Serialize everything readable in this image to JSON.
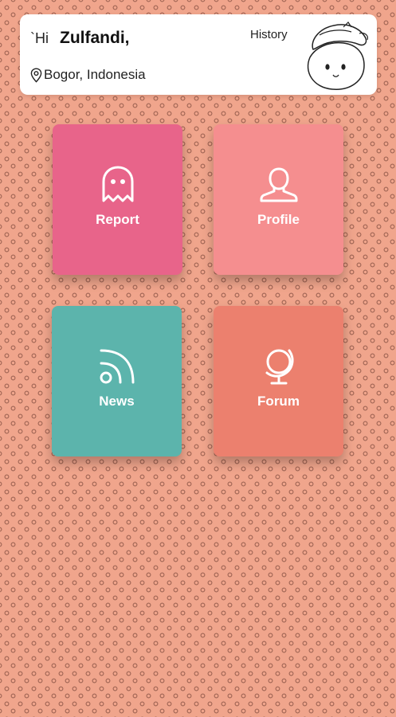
{
  "header": {
    "greeting": "`Hi",
    "user_name": "Zulfandi,",
    "location": "Bogor, Indonesia",
    "history_label": "History",
    "mascot_icon": "mascot-face-icon",
    "location_icon": "map-pin-icon"
  },
  "menu": {
    "tiles": [
      {
        "label": "Report",
        "icon": "ghost-icon",
        "color": "#e8648a"
      },
      {
        "label": "Profile",
        "icon": "person-icon",
        "color": "#f58e8f"
      },
      {
        "label": "News",
        "icon": "rss-icon",
        "color": "#5cb4ac"
      },
      {
        "label": "Forum",
        "icon": "globe-icon",
        "color": "#ec806e"
      }
    ]
  },
  "theme": {
    "background": "#f0a58c",
    "card": "#ffffff"
  }
}
